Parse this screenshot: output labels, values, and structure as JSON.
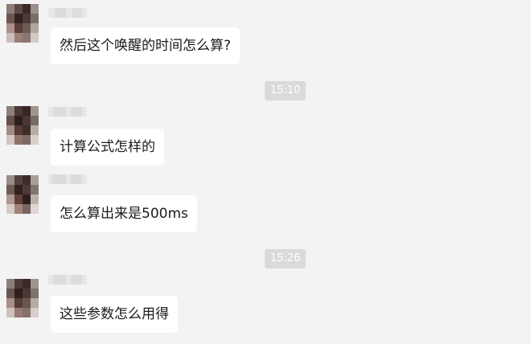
{
  "messages": [
    {
      "text": "然后这个唤醒的时间怎么算?"
    },
    {
      "text": "计算公式怎样的"
    },
    {
      "text": "怎么算出来是500ms"
    },
    {
      "text": "这些参数怎么用得"
    }
  ],
  "timestamps": [
    {
      "label": "15:10"
    },
    {
      "label": "15:26"
    }
  ],
  "colors": {
    "background": "#f3f3f3",
    "bubble": "#ffffff",
    "timestamp_badge": "#dadada"
  }
}
